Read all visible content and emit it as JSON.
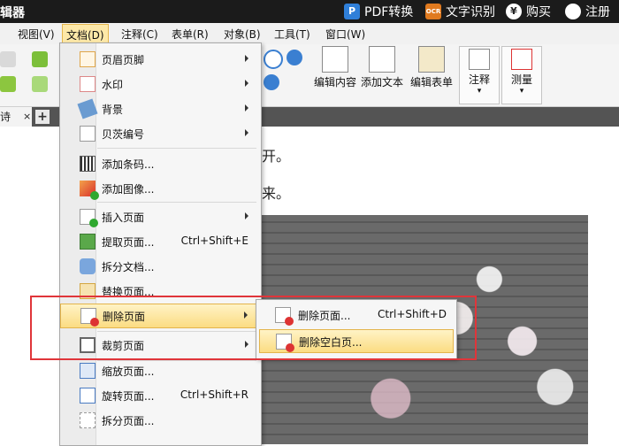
{
  "titlebar": {
    "app_title": "辑器",
    "pdf_convert": "PDF转换",
    "ocr_badge": "OCR",
    "ocr": "文字识别",
    "buy_symbol": "¥",
    "buy": "购买",
    "register": "注册"
  },
  "menubar": {
    "view": "视图(V)",
    "document": "文档(D)",
    "comment": "注释(C)",
    "form": "表单(R)",
    "object": "对象(B)",
    "tools": "工具(T)",
    "window": "窗口(W)"
  },
  "toolbar": {
    "edit_content": "编辑内容",
    "add_text": "添加文本",
    "edit_form": "编辑表单",
    "comment": "注释",
    "measure": "测量",
    "dropdown_caret": "▾"
  },
  "tabs": {
    "doc_tab": "诗",
    "close": "×",
    "add": "+"
  },
  "document": {
    "line1": "开。",
    "line2": "来。"
  },
  "doc_menu": {
    "items": [
      {
        "label": "页眉页脚",
        "shortcut": "",
        "icon": "header-footer-icon"
      },
      {
        "label": "水印",
        "shortcut": "",
        "icon": "watermark-icon"
      },
      {
        "label": "背景",
        "shortcut": "",
        "icon": "background-icon"
      },
      {
        "label": "贝茨编号",
        "shortcut": "",
        "icon": "bates-number-icon"
      },
      {
        "label": "添加条码...",
        "shortcut": "",
        "icon": "barcode-icon"
      },
      {
        "label": "添加图像...",
        "shortcut": "",
        "icon": "add-image-icon"
      },
      {
        "label": "插入页面",
        "shortcut": "",
        "icon": "insert-page-icon"
      },
      {
        "label": "提取页面...",
        "shortcut": "Ctrl+Shift+E",
        "icon": "extract-page-icon"
      },
      {
        "label": "拆分文档...",
        "shortcut": "",
        "icon": "split-document-icon"
      },
      {
        "label": "替换页面...",
        "shortcut": "",
        "icon": "replace-page-icon"
      },
      {
        "label": "删除页面",
        "shortcut": "",
        "icon": "delete-page-icon"
      },
      {
        "label": "裁剪页面",
        "shortcut": "",
        "icon": "crop-page-icon"
      },
      {
        "label": "缩放页面...",
        "shortcut": "",
        "icon": "scale-page-icon"
      },
      {
        "label": "旋转页面...",
        "shortcut": "Ctrl+Shift+R",
        "icon": "rotate-page-icon"
      },
      {
        "label": "拆分页面...",
        "shortcut": "",
        "icon": "split-page-icon"
      }
    ]
  },
  "delete_submenu": {
    "items": [
      {
        "label": "删除页面...",
        "shortcut": "Ctrl+Shift+D",
        "icon": "delete-page-icon"
      },
      {
        "label": "删除空白页...",
        "shortcut": "",
        "icon": "delete-blank-page-icon"
      }
    ]
  },
  "colors": {
    "highlight": "#fbdc82",
    "annotation": "#e0353a",
    "titlebar": "#1b1b1b"
  }
}
